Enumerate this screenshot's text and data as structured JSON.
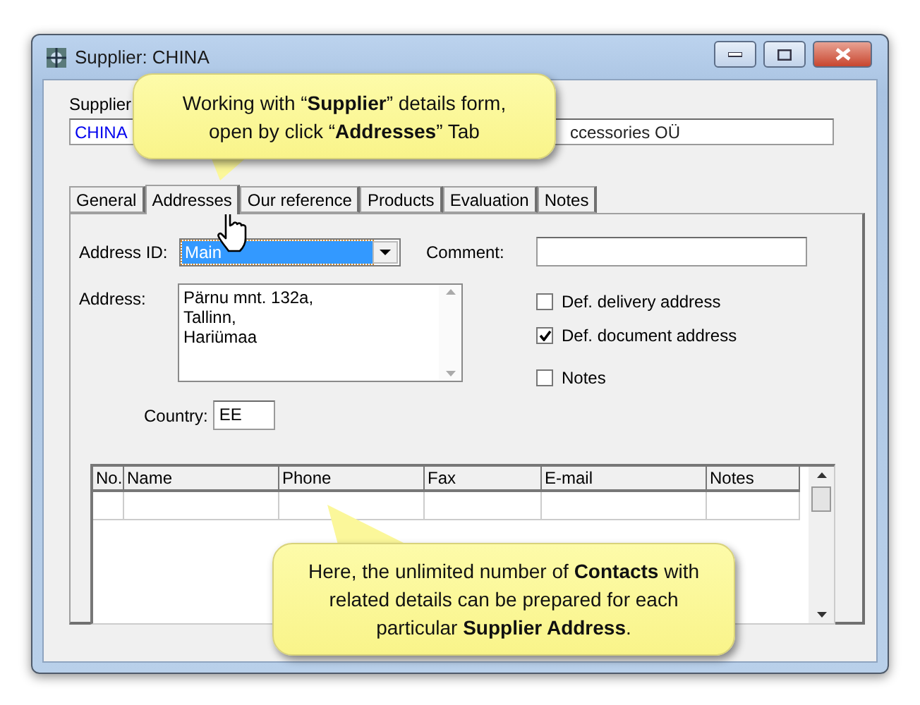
{
  "window": {
    "title": "Supplier: CHINA"
  },
  "header": {
    "label": "Supplier",
    "code": "CHINA",
    "name": "ccessories OÜ"
  },
  "tabs": [
    {
      "label": "General",
      "selected": false
    },
    {
      "label": "Addresses",
      "selected": true
    },
    {
      "label": "Our reference",
      "selected": false
    },
    {
      "label": "Products",
      "selected": false
    },
    {
      "label": "Evaluation",
      "selected": false
    },
    {
      "label": "Notes",
      "selected": false
    }
  ],
  "form": {
    "address_id": {
      "label": "Address ID:",
      "value": "Main"
    },
    "comment": {
      "label": "Comment:"
    },
    "address": {
      "label": "Address:",
      "lines": [
        "Pärnu mnt. 132a,",
        "Tallinn,",
        "Hariümaa"
      ]
    },
    "country": {
      "label": "Country:",
      "value": "EE"
    },
    "checkboxes": [
      {
        "label": "Def. delivery address",
        "checked": false
      },
      {
        "label": "Def. document address",
        "checked": true
      },
      {
        "label": "Notes",
        "checked": false
      }
    ]
  },
  "contacts": {
    "columns": [
      "No.",
      "Name",
      "Phone",
      "Fax",
      "E-mail",
      "Notes"
    ]
  },
  "callouts": [
    {
      "text": "Working with “**Supplier**” details form, open by click “**Addresses**” Tab"
    },
    {
      "text": "Here, the unlimited number of **Contacts** with related details can be prepared for each particular **Supplier Address**."
    }
  ]
}
